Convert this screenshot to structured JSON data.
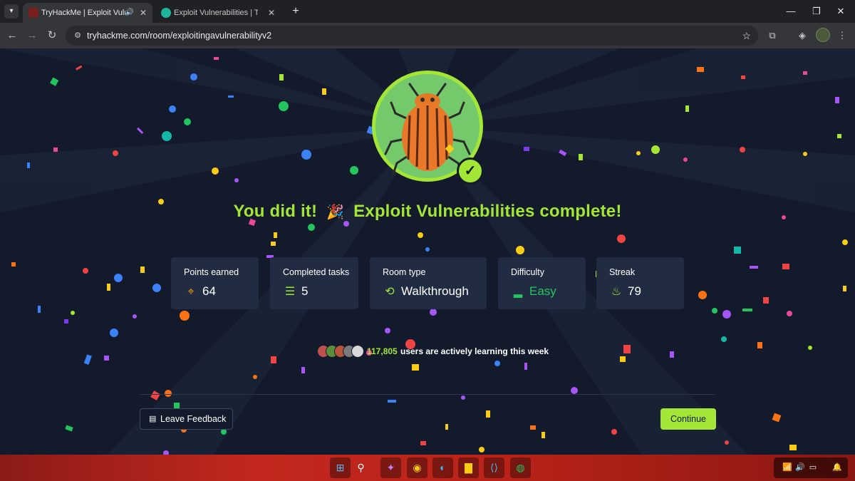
{
  "browser": {
    "tabs": [
      {
        "title": "TryHackMe | Exploit Vulnera",
        "active": true
      },
      {
        "title": "Exploit Vulnerabilities | TryHack",
        "active": false
      }
    ],
    "url": "tryhackme.com/room/exploitingavulnerabilityv2"
  },
  "completion": {
    "headline_prefix": "You did it!",
    "headline_emoji": "🎉",
    "headline_suffix": "Exploit Vulnerabilities complete!"
  },
  "stats": [
    {
      "label": "Points earned",
      "value": "64",
      "icon": "target-icon",
      "icon_color": "#f59e0b"
    },
    {
      "label": "Completed tasks",
      "value": "5",
      "icon": "task-list-icon",
      "icon_color": "#a3e635"
    },
    {
      "label": "Room type",
      "value": "Walkthrough",
      "icon": "walkthrough-path-icon",
      "icon_color": "#a3e635"
    },
    {
      "label": "Difficulty",
      "value": "Easy",
      "icon": "difficulty-bars-icon",
      "icon_color": "#22c55e"
    },
    {
      "label": "Streak",
      "value": "79",
      "icon": "flame-icon",
      "icon_color": "#a3e635"
    }
  ],
  "learners": {
    "count": "117,805",
    "text": "users are actively learning this week"
  },
  "actions": {
    "feedback_label": "Leave Feedback",
    "continue_label": "Continue"
  },
  "colors": {
    "accent": "#a3e635",
    "card_bg": "#212c42",
    "page_bg": "#131a2c",
    "taskbar": "#c2281f"
  }
}
